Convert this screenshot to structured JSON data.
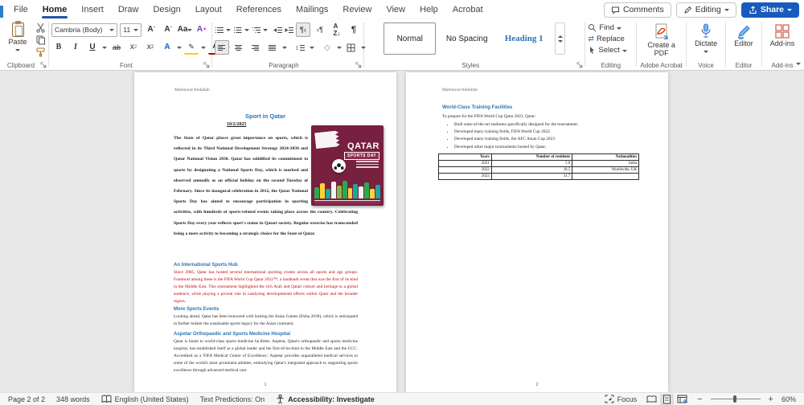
{
  "ribbon": {
    "tabs": [
      "File",
      "Home",
      "Insert",
      "Draw",
      "Design",
      "Layout",
      "References",
      "Mailings",
      "Review",
      "View",
      "Help",
      "Acrobat"
    ],
    "active_tab": "Home",
    "top": {
      "comments": "Comments",
      "editing": "Editing",
      "share": "Share"
    },
    "clipboard": {
      "paste": "Paste",
      "label": "Clipboard"
    },
    "font": {
      "name": "Cambria (Body)",
      "size": "11",
      "label": "Font"
    },
    "paragraph": {
      "label": "Paragraph"
    },
    "styles": {
      "items": [
        "Normal",
        "No Spacing",
        "Heading 1"
      ],
      "label": "Styles"
    },
    "editing_group": {
      "find": "Find",
      "replace": "Replace",
      "select": "Select",
      "label": "Editing"
    },
    "acrobat": {
      "button": "Create a PDF",
      "label": "Adobe Acrobat"
    },
    "voice": {
      "button": "Dictate",
      "label": "Voice"
    },
    "editor": {
      "button": "Editor",
      "label": "Editor"
    },
    "addins": {
      "button": "Add-ins",
      "label": "Add-ins"
    }
  },
  "page1": {
    "header": "Mahmoud Abdallah",
    "title": "Sport in Qatar",
    "date": "18/2/2025",
    "intro": "The State of Qatar places great importance on sports, which is reflected in its Third National Development Strategy 2024-2030 and Qatar National Vision 2030. Qatar has solidified its commitment to sports by designating a National Sports Day, which is marked and observed annually as an official holiday on the second Tuesday of February. Since its inaugural celebration in 2012, the Qatar National Sports Day has aimed to encourage participation in sporting activities, with hundreds of sports-related events taking place across the country. Celebrating Sports Day every year reflects sport's status in Qatari society. Regular exercise has transcended being a mere activity to becoming a strategic choice for the State of Qatar.",
    "poster": {
      "title": "QATAR",
      "subtitle": "SPORTS DAY"
    },
    "sections": [
      {
        "heading": "An International Sports Hub",
        "body": "Since 2005, Qatar has hosted several international sporting events across all sports and age groups. Foremost among these is the FIFA World Cup Qatar 2022™, a landmark event that was the first of its kind in the Middle East. This tournament highlighted the rich Arab and Qatari culture and heritage to a global audience, while playing a pivotal role in catalysing developmental efforts within Qatar and the broader region."
      },
      {
        "heading": "More Sports Events",
        "body": "Looking ahead, Qatar has been honoured with hosting the Asian Games (Doha 2030), which is anticipated to further bolster the sustainable sports legacy for the Asian continent."
      },
      {
        "heading": "Aspetar Orthopaedic and Sports Medicine Hospital",
        "body": "Qatar is home to world-class sports medicine facilities. Aspetar, Qatar's orthopaedic and sports medicine hospital, has established itself as a global leader and the first-of-its-kind in the Middle East and the GCC. Accredited as a 'FIFA Medical Centre of Excellence,' Aspetar provides unparalleled medical services to some of the world's most prominent athletes, embodying Qatar's integrated approach to supporting sports excellence through advanced medical care."
      }
    ],
    "page_number": "1"
  },
  "page2": {
    "header": "Mahmoud Abdallah",
    "heading": "World-Class Training Facilities",
    "intro": "To prepare for the FIFA World Cup Qatar 2022, Qatar:",
    "bullets": [
      "Built state-of-the-art stadiums specifically designed for the tournament.",
      "Developed many training fields, FIFA World Cup 2022.",
      "Developed many training fields, the AFC Asian Cup 2023",
      "Developed other major tournaments hosted by Qatar."
    ],
    "table": {
      "headers": [
        "Years",
        "Number of residents",
        "Nationalities"
      ],
      "rows": [
        [
          "2021",
          "5.8",
          "India"
        ],
        [
          "2022",
          "18.5",
          "Worldwide, UK"
        ],
        [
          "2023",
          "31.7",
          ""
        ]
      ]
    },
    "page_number": "2"
  },
  "status": {
    "page_info": "Page 2 of 2",
    "words": "348 words",
    "language": "English (United States)",
    "predictions": "Text Predictions: On",
    "accessibility": "Accessibility: Investigate",
    "focus": "Focus",
    "zoom": "60%"
  },
  "colors": {
    "accent": "#185abd",
    "heading_blue": "#2e74b5",
    "red_text": "#c00000",
    "poster_maroon": "#77203f"
  },
  "icons": {
    "comments": "speech-bubble",
    "editing_mode": "pencil",
    "share": "share-arrow",
    "find": "magnifier",
    "dictate": "microphone",
    "addins": "grid",
    "accessibility": "person",
    "views": [
      "read-mode",
      "print-layout",
      "web-layout"
    ]
  }
}
